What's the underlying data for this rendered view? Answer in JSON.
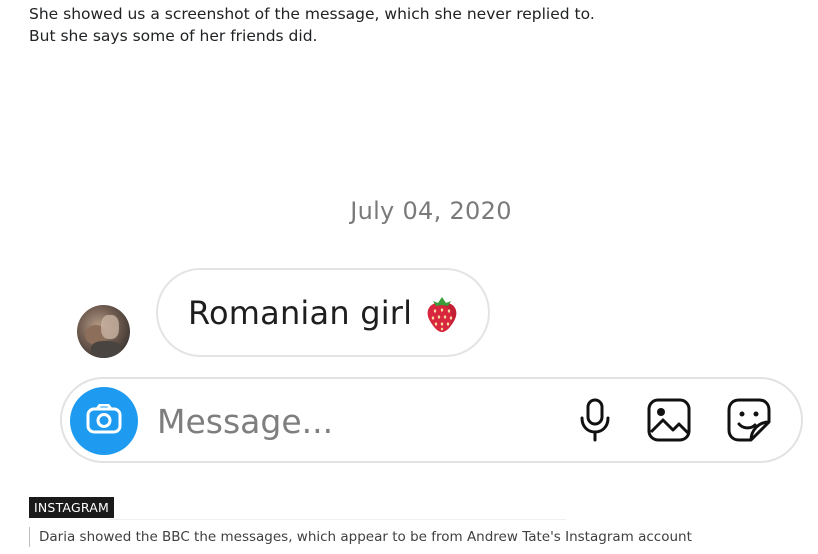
{
  "article": {
    "paragraph": "She showed us a screenshot of the message, which she never replied to. But she says some of her friends did."
  },
  "chat": {
    "date": "July 04, 2020",
    "message": {
      "text": "Romanian girl",
      "emoji_icon": "strawberry-icon"
    },
    "composer": {
      "placeholder": "Message...",
      "icons": [
        "camera-icon",
        "microphone-icon",
        "gallery-icon",
        "sticker-icon"
      ],
      "camera_color": "#1e9bf0"
    }
  },
  "caption": {
    "label": "INSTAGRAM",
    "text": "Daria showed the BBC the messages, which appear to be from Andrew Tate's Instagram account"
  }
}
